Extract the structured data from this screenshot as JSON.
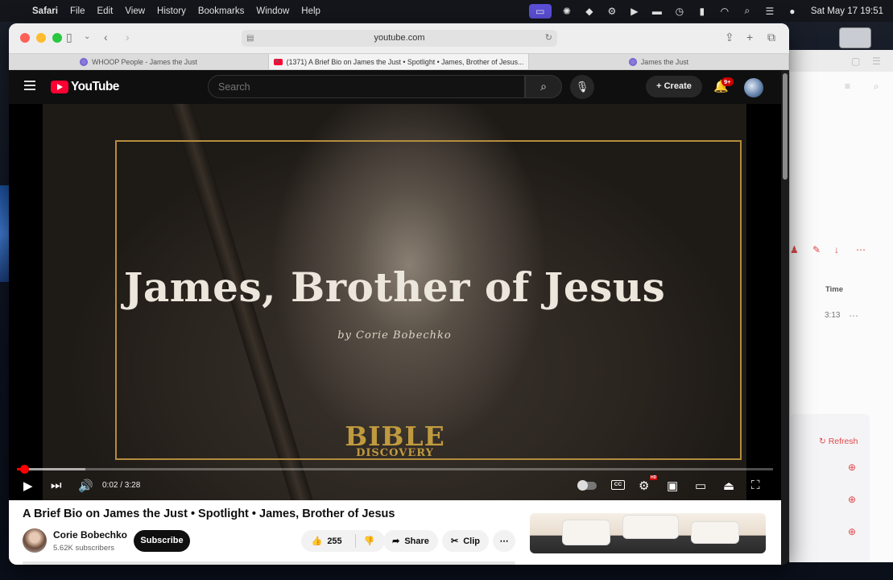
{
  "menubar": {
    "app": "Safari",
    "items": [
      "File",
      "Edit",
      "View",
      "History",
      "Bookmarks",
      "Window",
      "Help"
    ],
    "clock": "Sat May 17  19:51"
  },
  "browser": {
    "url": "youtube.com",
    "tabs": [
      {
        "title": "WHOOP People - James the Just"
      },
      {
        "title": "(1371) A Brief Bio on James the Just • Spotlight • James, Brother of Jesus..."
      },
      {
        "title": "James the Just"
      }
    ]
  },
  "youtube": {
    "logo": "YouTube",
    "search_placeholder": "Search",
    "create_label": "Create",
    "notifications_badge": "9+",
    "video": {
      "overlay_title": "James, Brother of Jesus",
      "overlay_subtitle": "by Corie Bobechko",
      "logo_line1": "BIBLE",
      "logo_line2": "DISCOVERY",
      "time": "0:02 / 3:28",
      "progress_played": 0.01,
      "progress_loaded": 0.09,
      "cc_label": "CC",
      "hd_label": "HD"
    },
    "title": "A Brief Bio on James the Just • Spotlight • James, Brother of Jesus",
    "channel": {
      "name": "Corie Bobechko",
      "subscribers": "5.62K subscribers"
    },
    "subscribe_label": "Subscribe",
    "likes": "255",
    "share_label": "Share",
    "clip_label": "Clip"
  },
  "background_window": {
    "time_header": "Time",
    "time_value": "3:13",
    "refresh_label": "Refresh"
  },
  "colors": {
    "youtube_red": "#ff0033",
    "accent_gold": "#b38d3e",
    "menubar_highlight": "#5b4fd8"
  }
}
